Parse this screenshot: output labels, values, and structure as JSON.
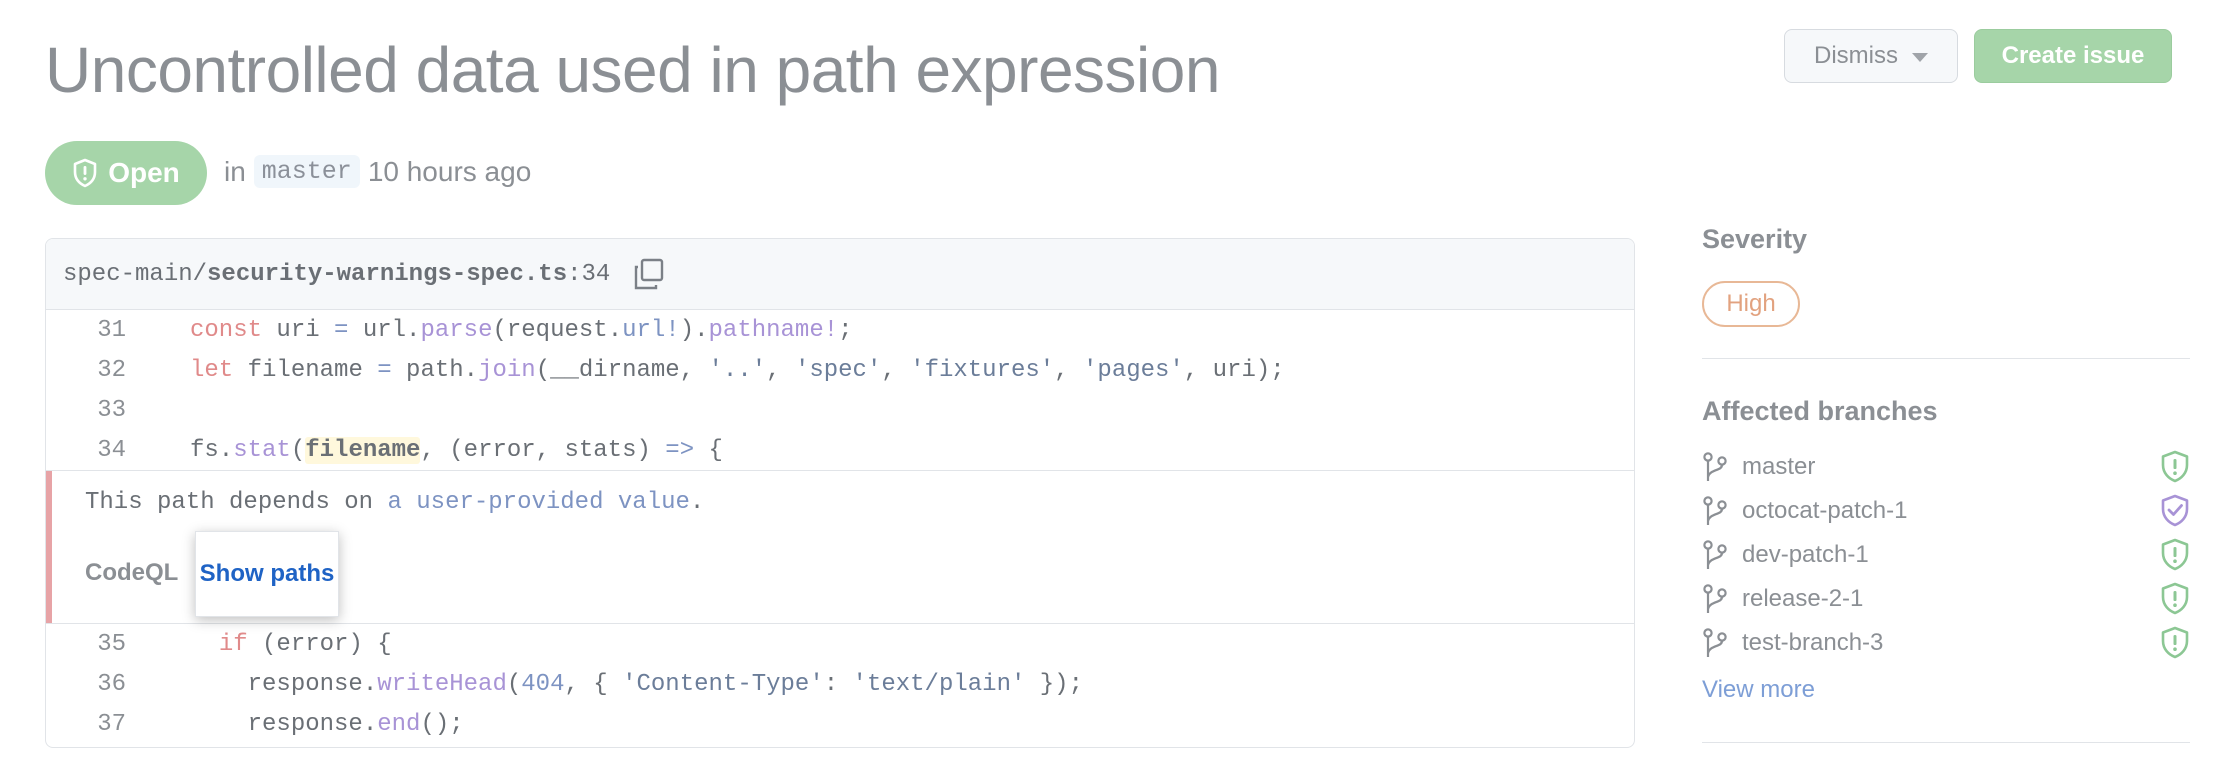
{
  "alert": {
    "title": "Uncontrolled data used in path expression",
    "status": "Open",
    "in_label": "in",
    "branch": "master",
    "time": "10 hours ago"
  },
  "actions": {
    "dismiss_label": "Dismiss",
    "create_issue_label": "Create issue"
  },
  "file": {
    "dir": "spec-main/",
    "name": "security-warnings-spec.ts",
    "line_suffix": ":34"
  },
  "code": {
    "lines_before": [
      {
        "num": "31",
        "text": "const uri = url.parse(request.url!).pathname!;"
      },
      {
        "num": "32",
        "text": "let filename = path.join(__dirname, '..', 'spec', 'fixtures', 'pages', uri);"
      },
      {
        "num": "33",
        "text": ""
      },
      {
        "num": "34",
        "text": "fs.stat(filename, (error, stats) => {"
      }
    ],
    "lines_after": [
      {
        "num": "35",
        "text": "  if (error) {"
      },
      {
        "num": "36",
        "text": "    response.writeHead(404, { 'Content-Type': 'text/plain' });"
      },
      {
        "num": "37",
        "text": "    response.end();"
      }
    ]
  },
  "message": {
    "prefix": "This path depends on ",
    "link": "a user-provided value",
    "suffix": ".",
    "tool": "CodeQL",
    "show_paths_label": "Show paths"
  },
  "sidebar": {
    "severity_heading": "Severity",
    "severity": "High",
    "branches_heading": "Affected branches",
    "branches": [
      {
        "name": "master",
        "status": "open"
      },
      {
        "name": "octocat-patch-1",
        "status": "fixed"
      },
      {
        "name": "dev-patch-1",
        "status": "open"
      },
      {
        "name": "release-2-1",
        "status": "open"
      },
      {
        "name": "test-branch-3",
        "status": "open"
      }
    ],
    "view_more_label": "View more"
  },
  "colors": {
    "open_green": "#a6d5a9",
    "severity_orange": "#e2a27f",
    "alert_red_bar": "#e7a3a6",
    "link_blue": "#1f63c5",
    "fixed_purple": "#a893d6"
  }
}
